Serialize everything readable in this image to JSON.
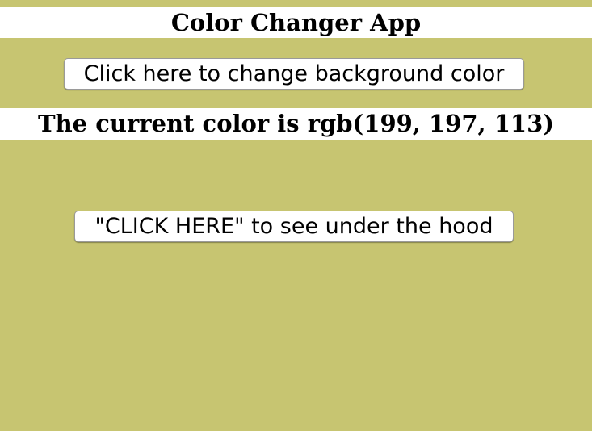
{
  "app": {
    "title": "Color Changer App",
    "background_color": "#c7c571"
  },
  "controls": {
    "change_button_label": "Click here to change background color",
    "hood_button_label": "\"CLICK HERE\" to see under the hood"
  },
  "status": {
    "current_color_text": "The current color is rgb(199, 197, 113)"
  }
}
